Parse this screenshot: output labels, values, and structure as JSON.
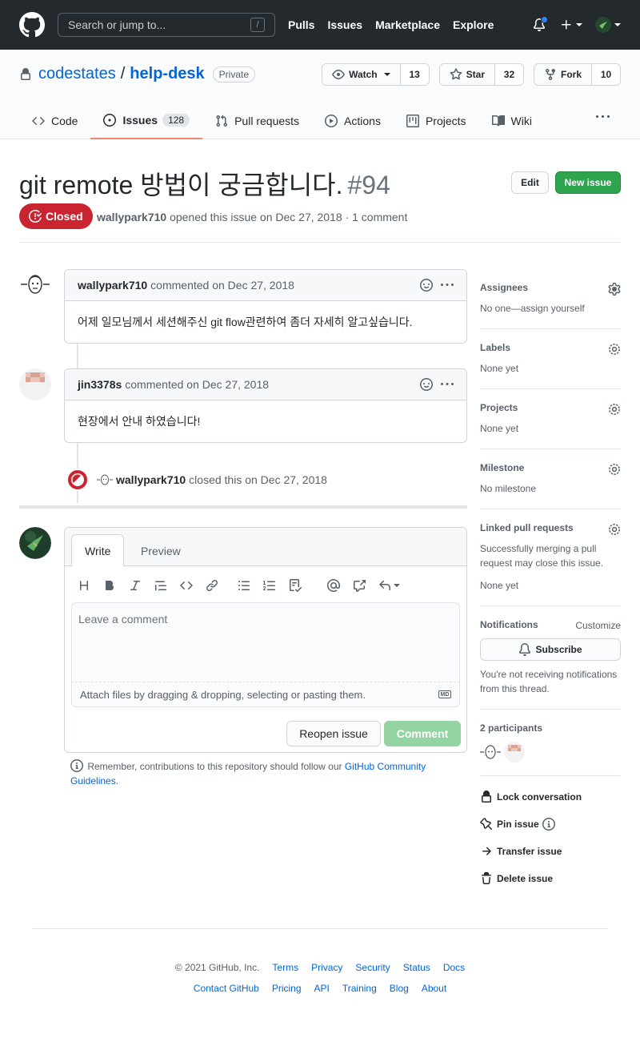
{
  "header": {
    "search_placeholder": "Search or jump to...",
    "search_shortcut": "/",
    "nav": [
      "Pulls",
      "Issues",
      "Marketplace",
      "Explore"
    ]
  },
  "repo": {
    "owner": "codestates",
    "name": "help-desk",
    "visibility": "Private",
    "watch_label": "Watch",
    "watch_count": "13",
    "star_label": "Star",
    "star_count": "32",
    "fork_label": "Fork",
    "fork_count": "10",
    "tabs": [
      {
        "label": "Code"
      },
      {
        "label": "Issues",
        "count": "128"
      },
      {
        "label": "Pull requests"
      },
      {
        "label": "Actions"
      },
      {
        "label": "Projects"
      },
      {
        "label": "Wiki"
      }
    ]
  },
  "issue": {
    "title": "git remote 방법이 궁금합니다.",
    "number": "#94",
    "edit_label": "Edit",
    "new_issue_label": "New issue",
    "state": "Closed",
    "author": "wallypark710",
    "meta_text": "opened this issue on Dec 27, 2018 · 1 comment"
  },
  "timeline": {
    "comments": [
      {
        "author": "wallypark710",
        "meta": "commented on Dec 27, 2018",
        "body": "어제 일모님께서 세션해주신 git flow관련하여 좀더 자세히 알고싶습니다."
      },
      {
        "author": "jin3378s",
        "meta": "commented on Dec 27, 2018",
        "body": "현장에서 안내 하였습니다!"
      }
    ],
    "event": {
      "actor": "wallypark710",
      "text": "closed this on Dec 27, 2018"
    }
  },
  "form": {
    "tab_write": "Write",
    "tab_preview": "Preview",
    "placeholder": "Leave a comment",
    "attach_text": "Attach files by dragging & dropping, selecting or pasting them.",
    "md_label": "MD",
    "reopen_label": "Reopen issue",
    "comment_label": "Comment",
    "remember_text": "Remember, contributions to this repository should follow our",
    "guidelines_link": "GitHub Community Guidelines",
    "guidelines_end": "."
  },
  "sidebar": {
    "assignees": {
      "title": "Assignees",
      "value": "No one—assign yourself"
    },
    "labels": {
      "title": "Labels",
      "value": "None yet"
    },
    "projects": {
      "title": "Projects",
      "value": "None yet"
    },
    "milestone": {
      "title": "Milestone",
      "value": "No milestone"
    },
    "linked": {
      "title": "Linked pull requests",
      "desc": "Successfully merging a pull request may close this issue.",
      "value": "None yet"
    },
    "notifications": {
      "title": "Notifications",
      "customize": "Customize",
      "subscribe": "Subscribe",
      "desc": "You're not receiving notifications from this thread."
    },
    "participants": {
      "title": "2 participants"
    },
    "actions": [
      "Lock conversation",
      "Pin issue",
      "Transfer issue",
      "Delete issue"
    ]
  },
  "footer": {
    "copyright": "© 2021 GitHub, Inc.",
    "row1": [
      "Terms",
      "Privacy",
      "Security",
      "Status",
      "Docs"
    ],
    "row2": [
      "Contact GitHub",
      "Pricing",
      "API",
      "Training",
      "Blog",
      "About"
    ]
  },
  "colors": {
    "header_bg": "#24292e",
    "closed_red": "#cb2431",
    "green": "#2ea44f",
    "link": "#0366d6",
    "active_tab": "#f9826c"
  }
}
